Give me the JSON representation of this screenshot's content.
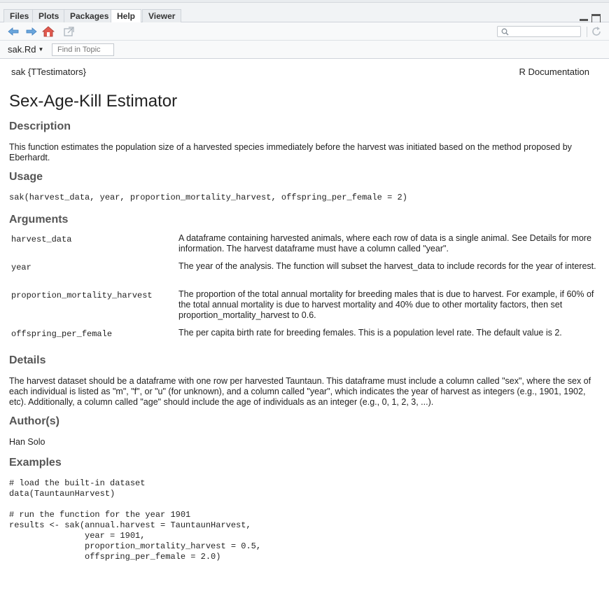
{
  "tabs": [
    {
      "label": "Files"
    },
    {
      "label": "Plots"
    },
    {
      "label": "Packages"
    },
    {
      "label": "Help"
    },
    {
      "label": "Viewer"
    }
  ],
  "toolbar": {
    "search_value": ""
  },
  "toolbar2": {
    "topic": "sak.Rd",
    "find_placeholder": "Find in Topic"
  },
  "doc": {
    "header_left": "sak {TTestimators}",
    "header_right": "R Documentation",
    "title": "Sex-Age-Kill Estimator",
    "sections": {
      "description_heading": "Description",
      "description_text": "This function estimates the population size of a harvested species immediately before the harvest was initiated based on the method proposed by Eberhardt.",
      "usage_heading": "Usage",
      "usage_code": "sak(harvest_data, year, proportion_mortality_harvest, offspring_per_female = 2)",
      "arguments_heading": "Arguments",
      "arguments": [
        {
          "name": "harvest_data",
          "desc": "A dataframe containing harvested animals, where each row of data is a single animal. See Details for more information. The harvest dataframe must have a column called \"year\"."
        },
        {
          "name": "year",
          "desc": "The year of the analysis. The function will subset the harvest_data to include records for the year of interest."
        },
        {
          "name": "proportion_mortality_harvest",
          "desc": "The proportion of the total annual mortality for breeding males that is due to harvest. For example, if 60% of the total annual mortality is due to harvest mortality and 40% due to other mortality factors, then set proportion_mortality_harvest to 0.6."
        },
        {
          "name": "offspring_per_female",
          "desc": "The per capita birth rate for breeding females. This is a population level rate. The default value is 2."
        }
      ],
      "details_heading": "Details",
      "details_text": "The harvest dataset should be a dataframe with one row per harvested Tauntaun. This dataframe must include a column called \"sex\", where the sex of each individual is listed as \"m\", \"f\", or \"u\" (for unknown), and a column called \"year\", which indicates the year of harvest as integers (e.g., 1901, 1902, etc). Additionally, a column called \"age\" should include the age of individuals as an integer (e.g., 0, 1, 2, 3, ...).",
      "authors_heading": "Author(s)",
      "authors_text": "Han Solo",
      "examples_heading": "Examples",
      "examples_code": "# load the built-in dataset\ndata(TauntaunHarvest)\n\n# run the function for the year 1901\nresults <- sak(annual.harvest = TauntaunHarvest,\n               year = 1901,\n               proportion_mortality_harvest = 0.5,\n               offspring_per_female = 2.0)"
    }
  },
  "icons": {
    "back": "back-arrow-icon",
    "forward": "forward-arrow-icon",
    "home": "home-icon",
    "popout": "popout-window-icon",
    "search": "search-icon",
    "refresh": "refresh-icon"
  },
  "colors": {
    "arrow_blue": "#5b9bd5",
    "home_red": "#d9534f",
    "heading_gray": "#555555"
  }
}
